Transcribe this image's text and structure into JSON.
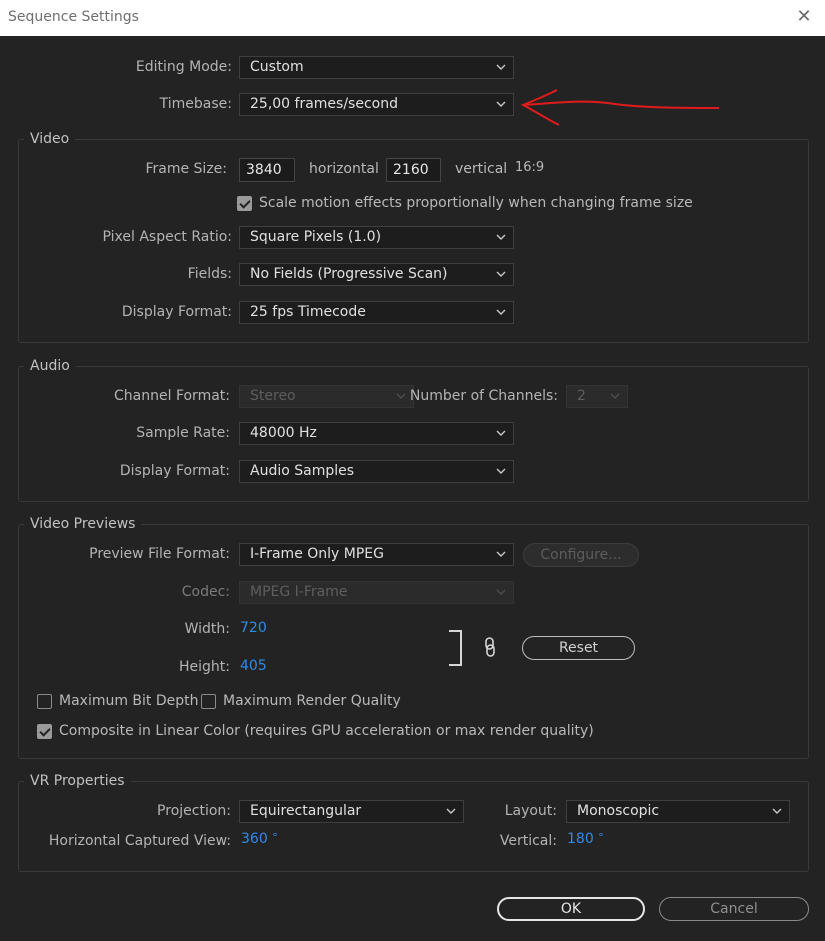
{
  "window": {
    "title": "Sequence Settings",
    "close_glyph": "✕"
  },
  "top": {
    "editing_mode": {
      "label": "Editing Mode:",
      "value": "Custom"
    },
    "timebase": {
      "label": "Timebase:",
      "value": "25,00  frames/second"
    }
  },
  "video": {
    "heading": "Video",
    "frame_size": {
      "label": "Frame Size:",
      "width": "3840",
      "horizontal": "horizontal",
      "height": "2160",
      "vertical": "vertical",
      "ratio": "16:9"
    },
    "scale_motion": {
      "label": "Scale motion effects proportionally when changing frame size",
      "checked": true
    },
    "pixel_aspect": {
      "label": "Pixel Aspect Ratio:",
      "value": "Square Pixels (1.0)"
    },
    "fields": {
      "label": "Fields:",
      "value": "No Fields (Progressive Scan)"
    },
    "display_format": {
      "label": "Display Format:",
      "value": "25 fps Timecode"
    }
  },
  "audio": {
    "heading": "Audio",
    "channel_format": {
      "label": "Channel Format:",
      "value": "Stereo"
    },
    "num_channels": {
      "label": "Number of Channels:",
      "value": "2"
    },
    "sample_rate": {
      "label": "Sample Rate:",
      "value": "48000 Hz"
    },
    "display_format": {
      "label": "Display Format:",
      "value": "Audio Samples"
    }
  },
  "previews": {
    "heading": "Video Previews",
    "file_format": {
      "label": "Preview File Format:",
      "value": "I-Frame Only MPEG"
    },
    "configure": "Configure...",
    "codec": {
      "label": "Codec:",
      "value": "MPEG I-Frame"
    },
    "width": {
      "label": "Width:",
      "value": "720"
    },
    "height": {
      "label": "Height:",
      "value": "405"
    },
    "reset": "Reset",
    "max_bit_depth": {
      "label": "Maximum Bit Depth",
      "checked": false
    },
    "max_render_quality": {
      "label": "Maximum Render Quality",
      "checked": false
    },
    "composite_linear": {
      "label": "Composite in Linear Color (requires GPU acceleration or max render quality)",
      "checked": true
    }
  },
  "vr": {
    "heading": "VR Properties",
    "projection": {
      "label": "Projection:",
      "value": "Equirectangular"
    },
    "layout": {
      "label": "Layout:",
      "value": "Monoscopic"
    },
    "h_view": {
      "label": "Horizontal Captured View:",
      "value": "360",
      "unit": "°"
    },
    "vertical": {
      "label": "Vertical:",
      "value": "180",
      "unit": "°"
    }
  },
  "footer": {
    "ok": "OK",
    "cancel": "Cancel"
  },
  "colors": {
    "accent_blue": "#2d8ceb",
    "annotation_red": "#e01b1b"
  }
}
